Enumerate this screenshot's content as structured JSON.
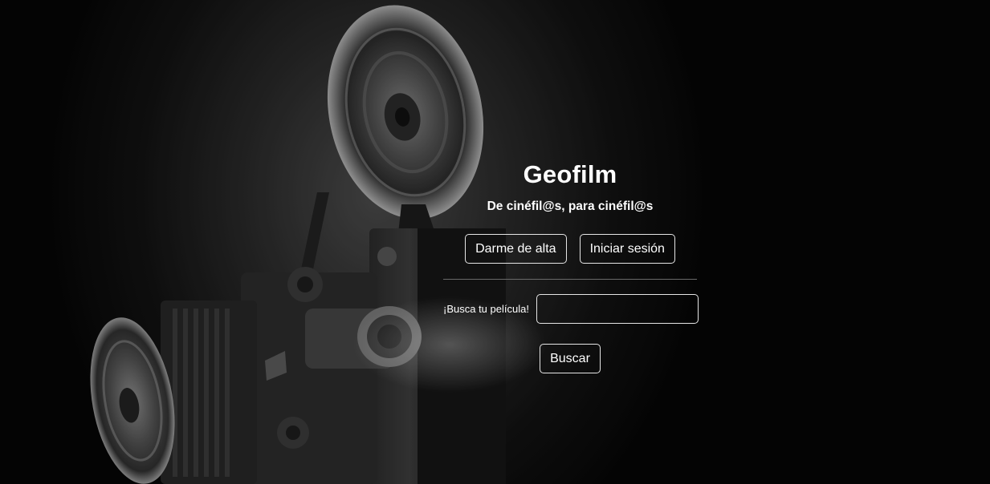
{
  "hero": {
    "title": "Geofilm",
    "subtitle": "De cinéfil@s, para cinéfil@s"
  },
  "auth": {
    "signup_label": "Darme de alta",
    "login_label": "Iniciar sesión"
  },
  "search": {
    "label": "¡Busca tu película!",
    "value": "",
    "button_label": "Buscar"
  },
  "colors": {
    "text": "#ffffff",
    "border": "#e6e6e6",
    "background": "#000000"
  },
  "background_image": "film-projector-photo"
}
